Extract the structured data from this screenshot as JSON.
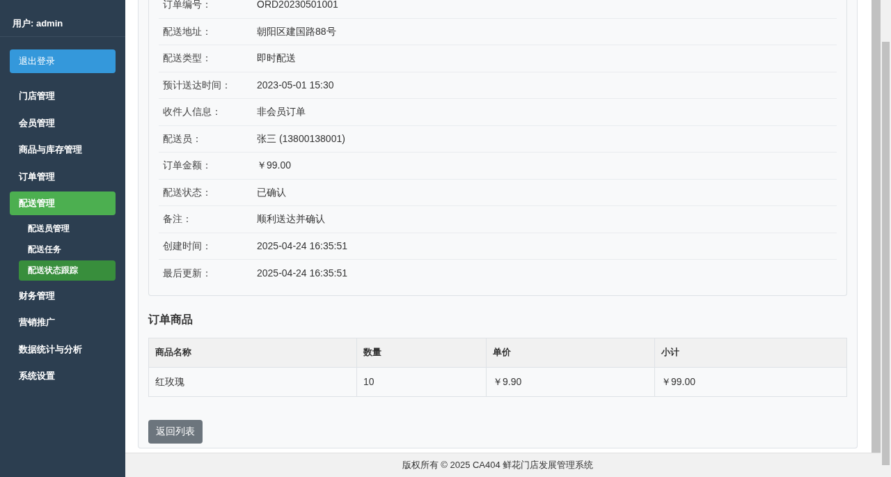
{
  "sidebar": {
    "user": "用户: admin",
    "logout": "退出登录",
    "items": [
      {
        "label": "门店管理",
        "selected": false
      },
      {
        "label": "会员管理",
        "selected": false
      },
      {
        "label": "商品与库存管理",
        "selected": false
      },
      {
        "label": "订单管理",
        "selected": false
      },
      {
        "label": "配送管理",
        "selected": true,
        "children": [
          {
            "label": "配送员管理",
            "selected": false
          },
          {
            "label": "配送任务",
            "selected": false
          },
          {
            "label": "配送状态跟踪",
            "selected": true
          }
        ]
      },
      {
        "label": "财务管理",
        "selected": false
      },
      {
        "label": "营销推广",
        "selected": false
      },
      {
        "label": "数据统计与分析",
        "selected": false
      },
      {
        "label": "系统设置",
        "selected": false
      }
    ]
  },
  "details": [
    {
      "label": "订单编号：",
      "value": "ORD20230501001"
    },
    {
      "label": "配送地址：",
      "value": "朝阳区建国路88号"
    },
    {
      "label": "配送类型：",
      "value": "即时配送"
    },
    {
      "label": "预计送达时间：",
      "value": "2023-05-01 15:30"
    },
    {
      "label": "收件人信息：",
      "value": "非会员订单"
    },
    {
      "label": "配送员：",
      "value": "张三 (13800138001)"
    },
    {
      "label": "订单金额：",
      "value": "￥99.00"
    },
    {
      "label": "配送状态：",
      "value": "已确认"
    },
    {
      "label": "备注：",
      "value": "顺利送达并确认"
    },
    {
      "label": "创建时间：",
      "value": "2025-04-24 16:35:51"
    },
    {
      "label": "最后更新：",
      "value": "2025-04-24 16:35:51"
    }
  ],
  "items_section": {
    "title": "订单商品",
    "columns": [
      "商品名称",
      "数量",
      "单价",
      "小计"
    ],
    "rows": [
      [
        "红玫瑰",
        "10",
        "￥9.90",
        "￥99.00"
      ]
    ]
  },
  "back_button": "返回列表",
  "footer": "版权所有 © 2025 CA404 鲜花门店发展管理系统"
}
